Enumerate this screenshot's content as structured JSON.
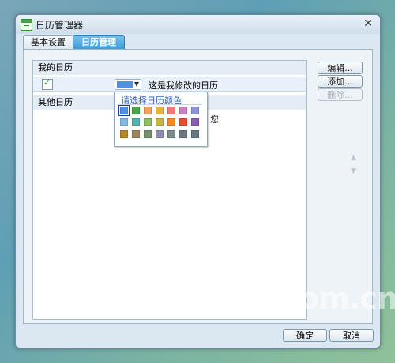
{
  "window": {
    "title": "日历管理器",
    "close": "✕"
  },
  "tabs": [
    {
      "label": "基本设置",
      "active": false
    },
    {
      "label": "日历管理",
      "active": true
    }
  ],
  "calendar_list": {
    "my_calendars_header": "我的日历",
    "my_calendar": {
      "checked": true,
      "color": "#4f93e0",
      "name": "这是我修改的日历"
    },
    "other_calendars_header": "其他日历",
    "partial_hint": "您"
  },
  "color_picker": {
    "title": "请选择日历颜色",
    "selected_index": 0,
    "colors": [
      "#4f93e0",
      "#46a847",
      "#f1a25c",
      "#e8b33c",
      "#ee7b77",
      "#c983c2",
      "#8f93d8",
      "#86b8e4",
      "#4fb5b3",
      "#8fbf5b",
      "#c8b53b",
      "#f08a23",
      "#ee4a2d",
      "#8b5db3",
      "#b6892c",
      "#9f8559",
      "#76936c",
      "#8e8eb4",
      "#7b8a8c",
      "#707882",
      "#677a86"
    ]
  },
  "side_buttons": {
    "edit": "编辑...",
    "add": "添加...",
    "delete": "删除..."
  },
  "reorder": {
    "up": "▲",
    "down": "▼"
  },
  "footer": {
    "ok": "确定",
    "cancel": "取消"
  },
  "watermark": "iT.com.cn"
}
